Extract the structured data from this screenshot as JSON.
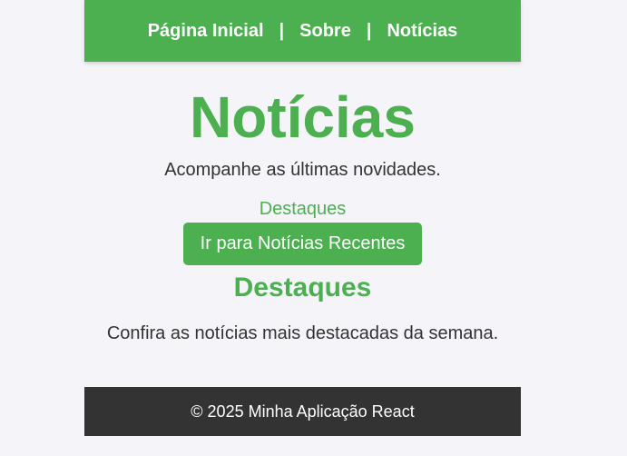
{
  "nav": {
    "items": [
      {
        "label": "Página Inicial"
      },
      {
        "label": "Sobre"
      },
      {
        "label": "Notícias"
      }
    ],
    "separator": "|"
  },
  "main": {
    "title": "Notícias",
    "subtitle": "Acompanhe as últimas novidades.",
    "anchor_link": "Destaques",
    "button_label": "Ir para Notícias Recentes",
    "section": {
      "title": "Destaques",
      "text": "Confira as notícias mais destacadas da semana."
    }
  },
  "footer": {
    "text": "© 2025 Minha Aplicação React"
  },
  "colors": {
    "accent": "#4caf50",
    "footer_bg": "#333333",
    "page_bg": "#f4f4f9"
  }
}
